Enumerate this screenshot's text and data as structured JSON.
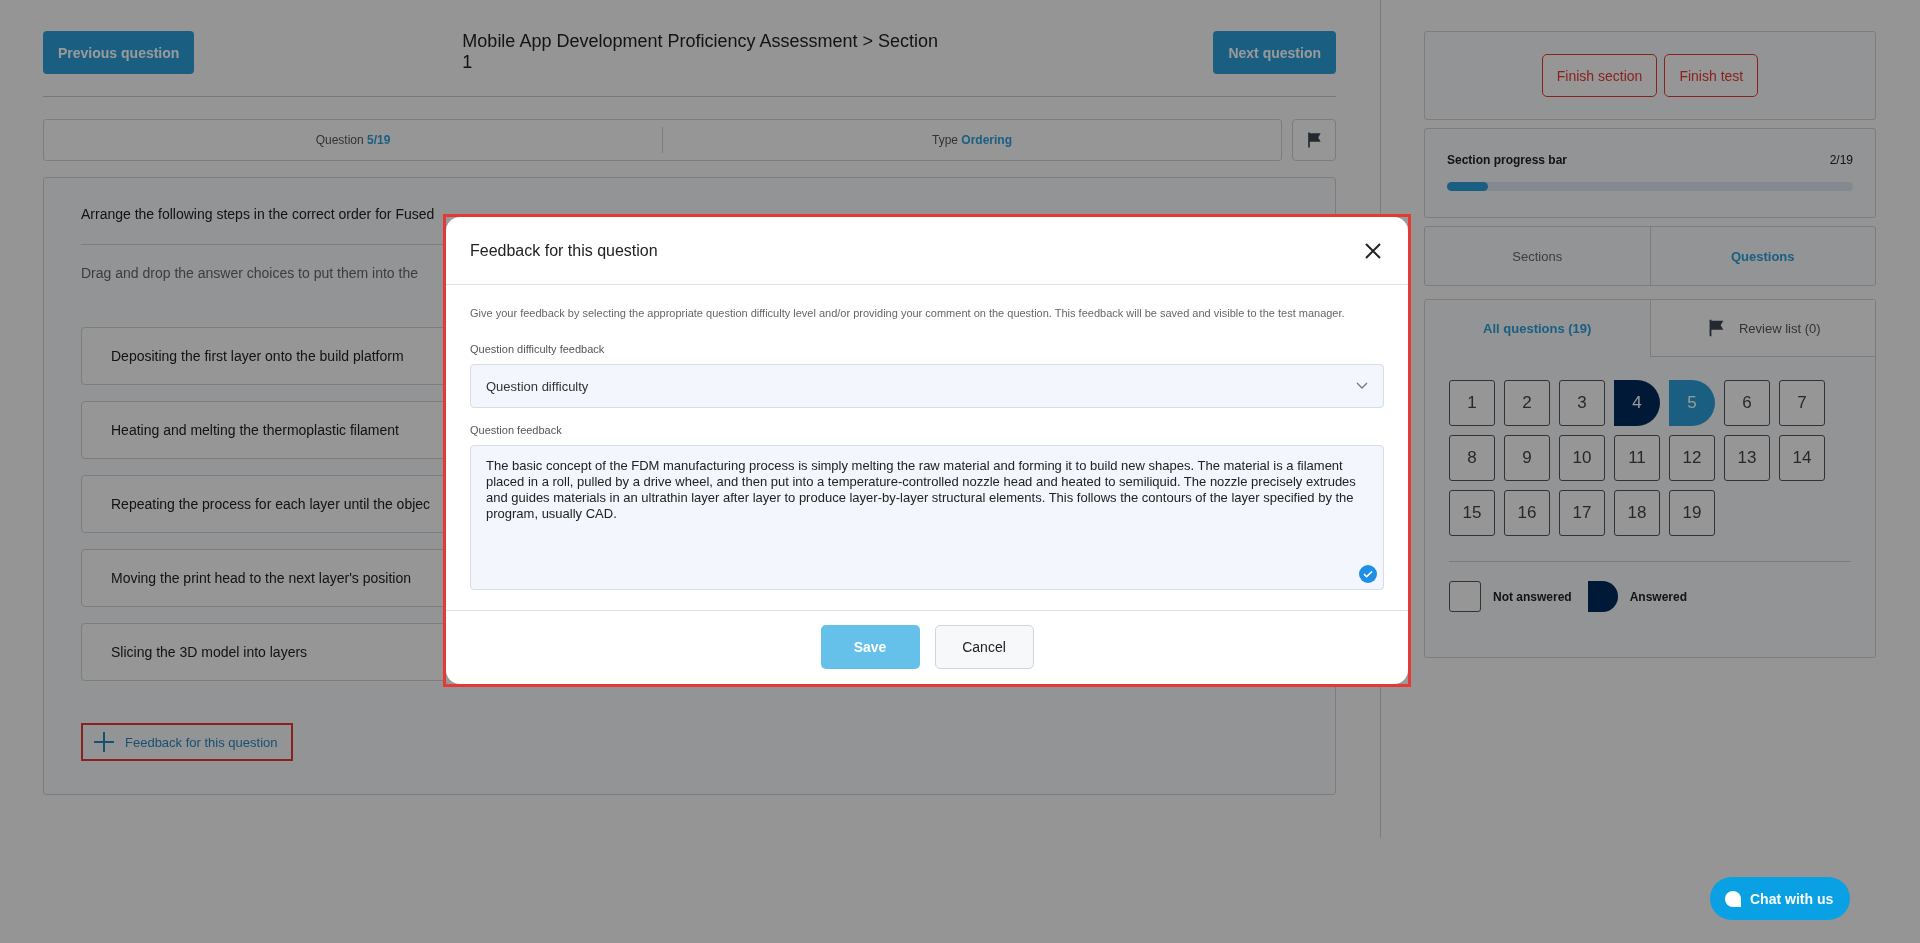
{
  "header": {
    "previous_button": "Previous question",
    "title": "Mobile App Development Proficiency Assessment > Section 1",
    "next_button": "Next question"
  },
  "info_bar": {
    "question_label": "Question",
    "question_value": "5/19",
    "type_label": "Type",
    "type_value": "Ordering"
  },
  "question": {
    "prompt": "Arrange the following steps in the correct order for Fused",
    "instruction": "Drag and drop the answer choices to put them into the",
    "choices": [
      "Depositing the first layer onto the build platform",
      "Heating and melting the thermoplastic filament",
      "Repeating the process for each layer until the objec",
      "Moving the print head to the next layer's position",
      "Slicing the 3D model into layers"
    ],
    "feedback_link": "Feedback for this question"
  },
  "sidebar": {
    "finish_buttons": [
      "Finish section",
      "Finish test"
    ],
    "progress": {
      "label": "Section progress bar",
      "count": "2/19",
      "level": 0.1
    },
    "view_tabs": [
      {
        "label": "Sections",
        "selected": false
      },
      {
        "label": "Questions",
        "selected": true
      }
    ],
    "list_tabs": [
      {
        "label": "All questions (19)",
        "selected": true,
        "kind": "plain"
      },
      {
        "label": "Review list (0)",
        "selected": false,
        "kind": "flag"
      }
    ],
    "questions": [
      {
        "number": "1",
        "answered": false,
        "selected": false
      },
      {
        "number": "2",
        "answered": false,
        "selected": false
      },
      {
        "number": "3",
        "answered": false,
        "selected": false
      },
      {
        "number": "4",
        "answered": true,
        "selected": false
      },
      {
        "number": "5",
        "answered": true,
        "selected": true
      },
      {
        "number": "6",
        "answered": false,
        "selected": false
      },
      {
        "number": "7",
        "answered": false,
        "selected": false
      },
      {
        "number": "8",
        "answered": false,
        "selected": false
      },
      {
        "number": "9",
        "answered": false,
        "selected": false
      },
      {
        "number": "10",
        "answered": false,
        "selected": false
      },
      {
        "number": "11",
        "answered": false,
        "selected": false
      },
      {
        "number": "12",
        "answered": false,
        "selected": false
      },
      {
        "number": "13",
        "answered": false,
        "selected": false
      },
      {
        "number": "14",
        "answered": false,
        "selected": false
      },
      {
        "number": "15",
        "answered": false,
        "selected": false
      },
      {
        "number": "16",
        "answered": false,
        "selected": false
      },
      {
        "number": "17",
        "answered": false,
        "selected": false
      },
      {
        "number": "18",
        "answered": false,
        "selected": false
      },
      {
        "number": "19",
        "answered": false,
        "selected": false
      }
    ],
    "legend": [
      {
        "label": "Not answered",
        "kind": "unanswered"
      },
      {
        "label": "Answered",
        "kind": "answered"
      }
    ]
  },
  "modal": {
    "title": "Feedback for this question",
    "description": "Give your feedback by selecting the appropriate question difficulty level and/or providing your comment on the question. This feedback will be saved and visible to the test manager.",
    "difficulty_label": "Question difficulty feedback",
    "difficulty_value": "Question difficulty",
    "feedback_label": "Question feedback",
    "feedback_value": "The basic concept of the FDM manufacturing process is simply melting the raw material and forming it to build new shapes. The material is a filament placed in a roll, pulled by a drive wheel, and then put into a temperature-controlled nozzle head and heated to semiliquid. The nozzle precisely extrudes and guides materials in an ultrathin layer after layer to produce layer-by-layer structural elements. This follows the contours of the layer specified by the program, usually CAD.",
    "save_button": "Save",
    "save_disabled": true,
    "cancel_button": "Cancel"
  },
  "chat_button": "Chat with us"
}
